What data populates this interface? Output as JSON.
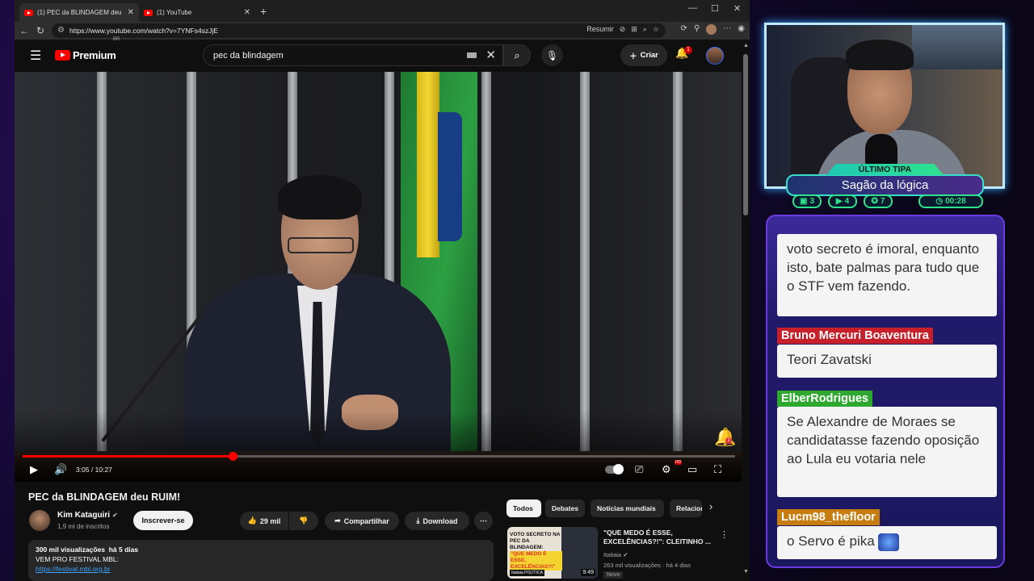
{
  "browser": {
    "tabs": [
      {
        "title": "(1) PEC da BLINDAGEM deu RUIM!",
        "close": "✕",
        "active": true
      },
      {
        "title": "(1) YouTube",
        "close": "✕",
        "active": false
      }
    ],
    "new_tab": "+",
    "window_controls": {
      "minimize": "—",
      "maximize": "☐",
      "close": "✕"
    },
    "nav": {
      "back": "←",
      "reload": "↻"
    },
    "url": "https://www.youtube.com/watch?v=7YNFs4szJjE",
    "omnibox_actions": {
      "summarize": "Resumir"
    }
  },
  "youtube_header": {
    "logo_text": "Premium",
    "logo_country": "BR",
    "search_value": "pec da blindagem",
    "create_label": "Criar",
    "notification_count": "1"
  },
  "video": {
    "current_time": "3:05",
    "duration": "10:27",
    "progress_fraction": 0.295,
    "overlay_bell_badge": "1",
    "hd_badge": "HD"
  },
  "below": {
    "title": "PEC da BLINDAGEM deu RUIM!",
    "channel_name": "Kim Kataguiri",
    "channel_subs": "1,9 mi de inscritos",
    "subscribe_label": "Inscrever-se",
    "likes": "29 mil",
    "share_label": "Compartilhar",
    "download_label": "Download",
    "more_label": "⋯",
    "description": {
      "views": "300 mil visualizações",
      "date": "há 5 dias",
      "line1": "VEM PRO FESTIVAL MBL:",
      "link": "https://festival.mbl.org.br"
    }
  },
  "chips": [
    "Todos",
    "Debates",
    "Notícias mundiais",
    "Relacionados"
  ],
  "recommended": {
    "title": "\"QUE MEDO É ESSE, EXCELÊNCIAS?!\": CLEITINHO ...",
    "channel": "Itatiaia",
    "meta": "263 mil visualizações · há 4 dias",
    "badge": "Novo",
    "duration": "9:49",
    "thumb_line1": "VOTO SECRETO NA",
    "thumb_line2": "PEC DA BLINDAGEM:",
    "thumb_line3": "\"QUE MEDO É ESSE,",
    "thumb_line4": "EXCELÊNCIAS?!\"",
    "thumb_brand": "Itatiaia POLÍTICA"
  },
  "overlay": {
    "tip_label": "ÚLTIMO TIPA",
    "tip_name": "Sagão da lógica",
    "stats": {
      "chat": "3",
      "video": "4",
      "gift": "7",
      "timer": "00:28"
    }
  },
  "chat": [
    {
      "user": "",
      "text": "voto secreto é imoral, enquanto isto, bate palmas para tudo que o STF vem fazendo."
    },
    {
      "user": "Bruno Mercuri Boaventura",
      "text": "Teori Zavatski"
    },
    {
      "user": "ElberRodrigues",
      "text": "Se Alexandre de Moraes se candidatasse fazendo oposição ao Lula eu votaria nele"
    },
    {
      "user": "Lucm98_thefloor",
      "text": "o Servo é pika"
    }
  ],
  "colors": {
    "youtube_red": "#ff0000",
    "chat_bruno": "#c8202a",
    "chat_elber": "#2ea82e",
    "chat_lucm": "#c77d10",
    "tip_accent": "#2ee28c"
  }
}
